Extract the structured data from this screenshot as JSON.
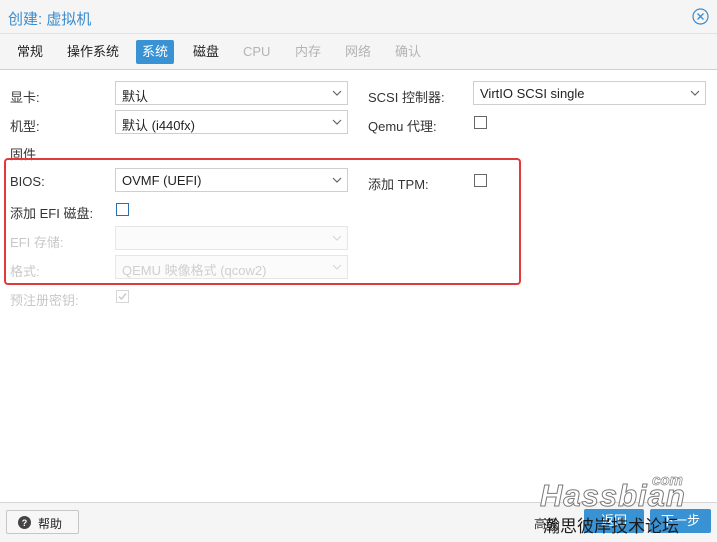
{
  "window": {
    "title": "创建: 虚拟机"
  },
  "tabs": [
    {
      "label": "常规",
      "state": "normal"
    },
    {
      "label": "操作系统",
      "state": "normal"
    },
    {
      "label": "系统",
      "state": "active"
    },
    {
      "label": "磁盘",
      "state": "normal"
    },
    {
      "label": "CPU",
      "state": "disabled"
    },
    {
      "label": "内存",
      "state": "disabled"
    },
    {
      "label": "网络",
      "state": "disabled"
    },
    {
      "label": "确认",
      "state": "disabled"
    }
  ],
  "form": {
    "display_label": "显卡:",
    "display_value": "默认",
    "scsi_label": "SCSI 控制器:",
    "scsi_value": "VirtIO SCSI single",
    "machine_label": "机型:",
    "machine_value": "默认 (i440fx)",
    "qemu_agent_label": "Qemu 代理:",
    "qemu_agent_checked": false,
    "firmware_header": "固件",
    "bios_label": "BIOS:",
    "bios_value": "OVMF (UEFI)",
    "tpm_label": "添加 TPM:",
    "tpm_checked": false,
    "efi_disk_label": "添加 EFI 磁盘:",
    "efi_disk_checked": false,
    "efi_storage_label": "EFI 存储:",
    "efi_storage_value": "",
    "format_label": "格式:",
    "format_value": "QEMU 映像格式 (qcow2)",
    "pre_enroll_label": "预注册密钥:",
    "pre_enroll_checked": true
  },
  "footer": {
    "help_label": "帮助",
    "advanced_label": "高级",
    "back_label": "返回",
    "next_label": "下一步"
  },
  "watermark": {
    "main": "Hassbian",
    "suffix": "com",
    "sub": "瀚思彼岸技术论坛"
  },
  "colors": {
    "accent": "#3892d4",
    "title": "#3a8cce",
    "highlight_border": "#e23a3a"
  },
  "icons": {
    "close": "close-circle-icon",
    "help": "question-circle-icon",
    "dropdown": "chevron-down-icon"
  }
}
